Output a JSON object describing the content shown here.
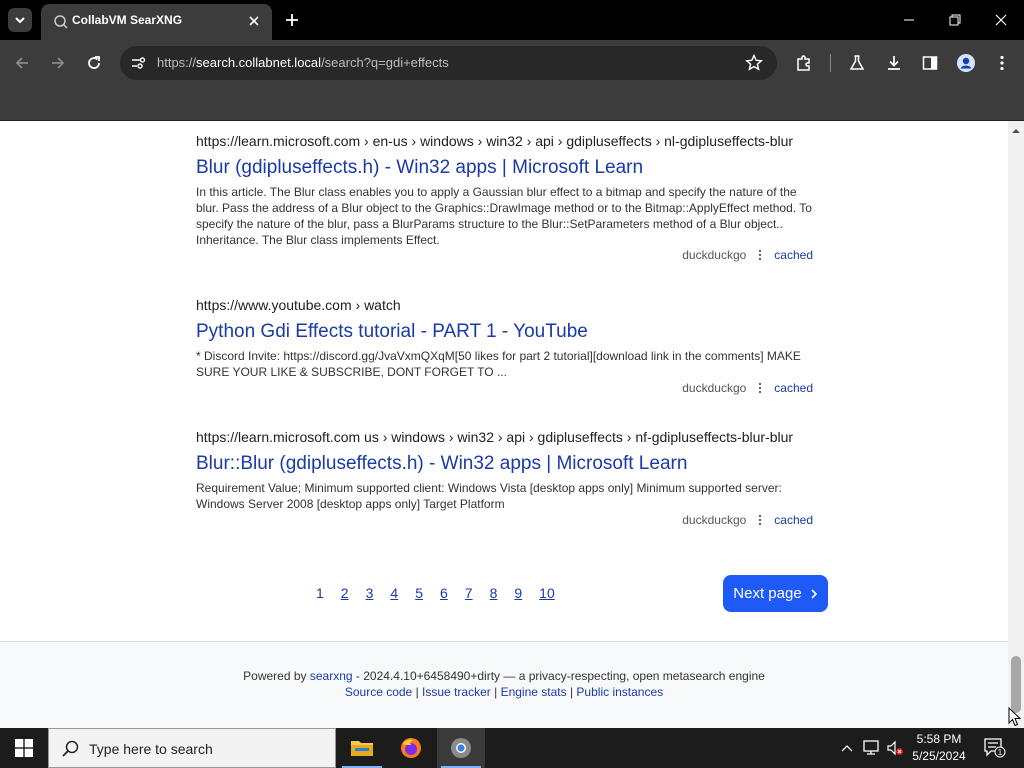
{
  "browser": {
    "tab_title": "CollabVM SearXNG",
    "url_scheme": "https://",
    "url_host": "search.collabnet.local",
    "url_path": "/search?q=gdi+effects"
  },
  "results": [
    {
      "url": "https://learn.microsoft.com  › en-us › windows › win32 › api › gdipluseffects › nl-gdipluseffects-blur",
      "title": "Blur (gdipluseffects.h) - Win32 apps | Microsoft Learn",
      "content": "In this article. The Blur class enables you to apply a Gaussian blur effect to a bitmap and specify the nature of the blur. Pass the address of a Blur object to the Graphics::DrawImage method or to the Bitmap::ApplyEffect method. To specify the nature of the blur, pass a BlurParams structure to the Blur::SetParameters method of a Blur object.. Inheritance. The Blur class implements Effect.",
      "engine": "duckduckgo",
      "cached": "cached"
    },
    {
      "url": "https://www.youtube.com  › watch",
      "title": "Python Gdi Effects tutorial - PART 1 - YouTube",
      "content": "* Discord Invite: https://discord.gg/JvaVxmQXqM[50 likes for part 2 tutorial][download link in the comments] MAKE SURE YOUR LIKE & SUBSCRIBE, DONT FORGET TO ...",
      "engine": "duckduckgo",
      "cached": "cached"
    },
    {
      "url": "https://learn.microsoft.com  us › windows › win32 › api › gdipluseffects › nf-gdipluseffects-blur-blur",
      "title": "Blur::Blur (gdipluseffects.h) - Win32 apps | Microsoft Learn",
      "content": "Requirement Value; Minimum supported client: Windows Vista [desktop apps only] Minimum supported server: Windows Server 2008 [desktop apps only] Target Platform",
      "engine": "duckduckgo",
      "cached": "cached"
    }
  ],
  "pagination": {
    "pages": [
      "1",
      "2",
      "3",
      "4",
      "5",
      "6",
      "7",
      "8",
      "9",
      "10"
    ],
    "current": "1",
    "next_label": "Next page"
  },
  "footer": {
    "powered_by": "Powered by",
    "searxng": "searxng",
    "version_text": "- 2024.4.10+6458490+dirty — a privacy-respecting, open metasearch engine",
    "source_code": "Source code",
    "issue_tracker": "Issue tracker",
    "engine_stats": "Engine stats",
    "public_instances": "Public instances",
    "sep": "|"
  },
  "taskbar": {
    "search_placeholder": "Type here to search",
    "time": "5:58 PM",
    "date": "5/25/2024",
    "notification_count": "1"
  },
  "colors": {
    "link": "#1a3aa6",
    "next_button": "#1e5bf6",
    "chrome_bg": "#3c3c3c"
  }
}
